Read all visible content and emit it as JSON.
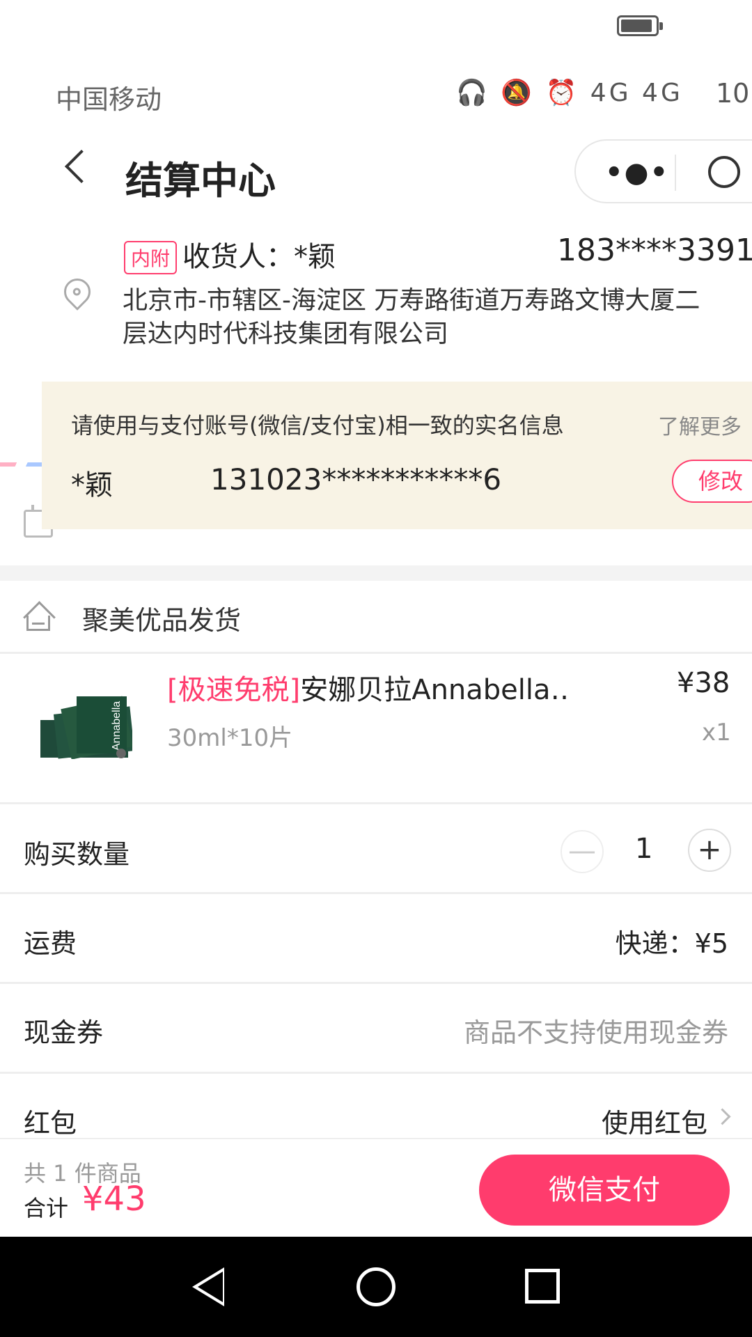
{
  "status_bar": {
    "carrier": "中国移动",
    "icons": "🎧 🔕 ⏰ 4G 4G",
    "time": "10:"
  },
  "header": {
    "title": "结算中心",
    "more_icon": "more-dots-icon",
    "close_icon": "target-ring-icon"
  },
  "address": {
    "tag": "内附",
    "recipient": "收货人：*颖",
    "phone": "183****3391",
    "detail": "北京市-市辖区-海淀区 万寿路街道万寿路文博大厦二层达内时代科技集团有限公司"
  },
  "id_notice": {
    "message": "请使用与支付账号(微信/支付宝)相一致的实名信息",
    "learn_more": "了解更多",
    "name": "*颖",
    "id_number": "131023***********6",
    "edit_label": "修改"
  },
  "shipping_source": {
    "label": "聚美优品发货"
  },
  "product": {
    "promo": "[极速免税]",
    "name": "安娜贝拉Annabella…",
    "price": "¥38",
    "spec": "30ml*10片",
    "quantity": "x1"
  },
  "purchase_qty": {
    "label": "购买数量",
    "minus": "—",
    "value": "1",
    "plus": "+"
  },
  "freight": {
    "label": "运费",
    "value": "快递：¥5"
  },
  "coupon": {
    "label": "现金券",
    "value": "商品不支持使用现金券"
  },
  "red_packet": {
    "label": "红包",
    "value": "使用红包"
  },
  "footer": {
    "item_count": "共 1 件商品",
    "total_label": "合计",
    "total_value": "¥43",
    "pay_button": "微信支付"
  },
  "colors": {
    "accent": "#ff3c6d",
    "notice_bg": "#f8f3e5",
    "muted_text": "#999999"
  }
}
